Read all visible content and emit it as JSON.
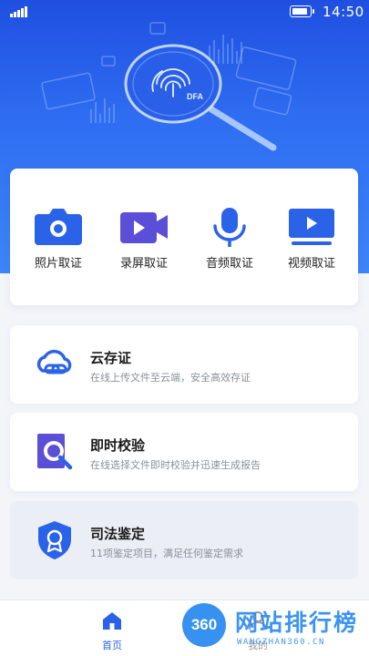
{
  "status_bar": {
    "time": "14:50",
    "signal_icon": "signal-icon",
    "battery_icon": "battery-icon"
  },
  "hero": {
    "illustration": "fingerprint-magnifier-illustration",
    "badge_text": "DFA"
  },
  "tools": [
    {
      "label": "照片取证",
      "icon": "camera-icon"
    },
    {
      "label": "录屏取证",
      "icon": "video-camera-icon"
    },
    {
      "label": "音频取证",
      "icon": "microphone-icon"
    },
    {
      "label": "视频取证",
      "icon": "monitor-play-icon"
    }
  ],
  "features": [
    {
      "title": "云存证",
      "desc": "在线上传文件至云端，安全高效存证",
      "icon": "cloud-link-icon"
    },
    {
      "title": "即时校验",
      "desc": "在线选择文件即时校验并迅速生成报告",
      "icon": "magnifier-check-icon"
    },
    {
      "title": "司法鉴定",
      "desc": "11项鉴定项目，满足任何鉴定需求",
      "icon": "shield-badge-icon"
    }
  ],
  "tab_bar": {
    "home_label": "首页",
    "mine_label": "我的"
  },
  "watermark": {
    "logo_text": "360",
    "title": "网站排行榜",
    "url": "WANGZHAN360.CN"
  },
  "colors": {
    "primary": "#2b63e8",
    "hero_top": "#1f4fe0",
    "hero_bottom": "#3c86f7",
    "icon_purple": "#5b4fd8",
    "watermark": "#2c8cf0"
  }
}
